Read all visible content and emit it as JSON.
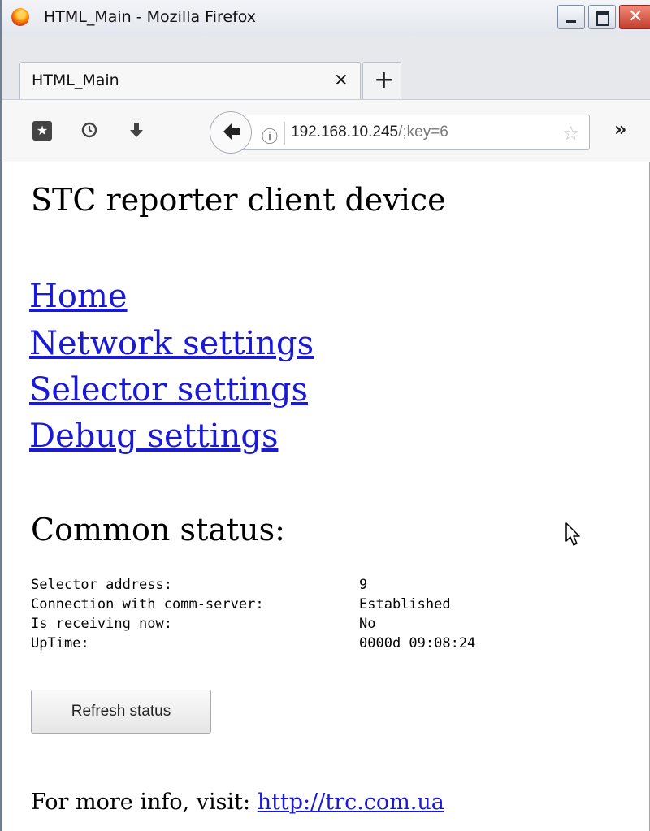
{
  "window": {
    "title": "HTML_Main - Mozilla Firefox"
  },
  "tab": {
    "title": "HTML_Main",
    "close_label": "×",
    "new_tab_label": "+"
  },
  "navbar": {
    "url_host": "192.168.10.245",
    "url_rest": "/;key=6",
    "info_icon": "ⓘ",
    "overflow_label": "»"
  },
  "page": {
    "title": "STC reporter client device",
    "links": {
      "home": "Home",
      "network": "Network settings",
      "selector": "Selector settings",
      "debug": "Debug settings"
    },
    "status_heading": "Common status:",
    "status": [
      {
        "key": "Selector address:",
        "value": "9"
      },
      {
        "key": "Connection with comm-server:",
        "value": "Established"
      },
      {
        "key": "Is receiving now:",
        "value": "No"
      },
      {
        "key": "UpTime:",
        "value": "0000d 09:08:24"
      }
    ],
    "refresh_button": "Refresh status",
    "footer_text": "For more info, visit: ",
    "footer_link": "http://trc.com.ua"
  },
  "icons": {
    "app": "firefox-icon",
    "library": "library-icon",
    "history": "history-icon",
    "downloads": "download-icon",
    "back": "back-arrow-icon",
    "bookmark": "star-icon",
    "cursor": "mouse-cursor-icon"
  }
}
